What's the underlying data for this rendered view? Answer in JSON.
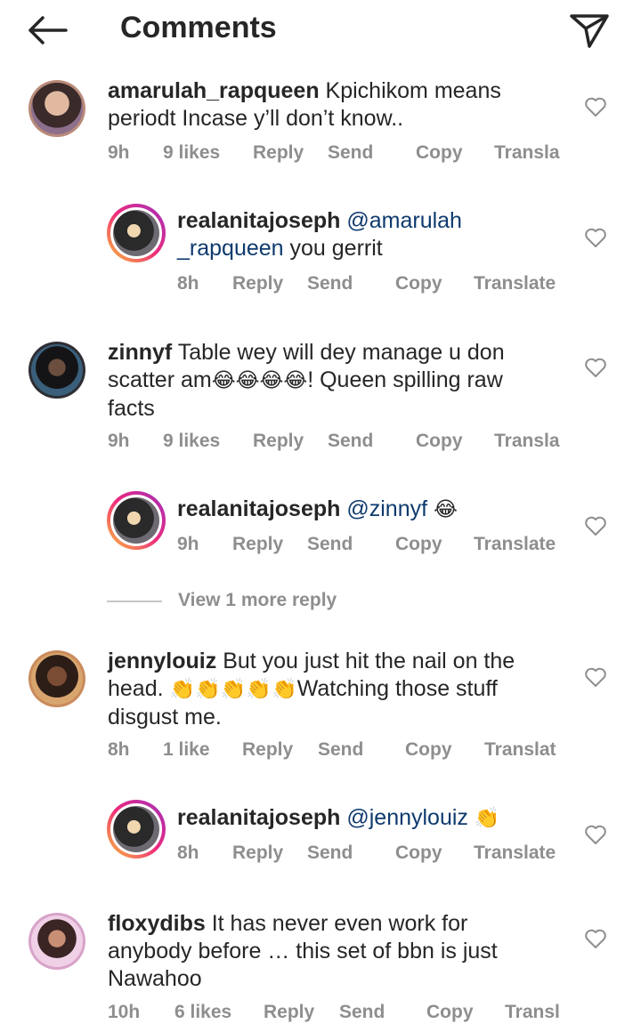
{
  "header": {
    "title": "Comments",
    "back_icon": "arrow-left-icon",
    "send_icon": "paper-plane-icon"
  },
  "comments": [
    {
      "user": "amarulah_rapqueen",
      "text": "Kpichikom means",
      "text2": "periodt Incase y’ll don’t know..",
      "time": "9h",
      "likes": "9 likes",
      "reply": "Reply",
      "send": "Send",
      "copy": "Copy",
      "translate": "Transla"
    },
    {
      "user": "realanitajoseph",
      "mention": "@amarulah",
      "mention2": "_rapqueen",
      "text2": " you gerrit",
      "time": "8h",
      "reply": "Reply",
      "send": "Send",
      "copy": "Copy",
      "translate": "Translate"
    },
    {
      "user": "zinnyf",
      "text": "Table wey will dey manage  u don",
      "text2a": "scatter am",
      "emoji2": "😂😂😂😂",
      "text2b": "! Queen spilling  raw",
      "text3": "facts",
      "time": "9h",
      "likes": "9 likes",
      "reply": "Reply",
      "send": "Send",
      "copy": "Copy",
      "translate": "Transla"
    },
    {
      "user": "realanitajoseph",
      "mention": "@zinnyf",
      "emoji": "😂",
      "time": "9h",
      "reply": "Reply",
      "send": "Send",
      "copy": "Copy",
      "translate": "Translate"
    },
    {
      "user": "jennylouiz",
      "text": "But you just hit the nail on the",
      "text2a": "head. ",
      "emoji2": "👏👏👏👏👏",
      "text2b": "Watching those stuff",
      "text3": "disgust me.",
      "time": "8h",
      "likes": "1 like",
      "reply": "Reply",
      "send": "Send",
      "copy": "Copy",
      "translate": "Translat"
    },
    {
      "user": "realanitajoseph",
      "mention": "@jennylouiz",
      "emoji": "👏",
      "time": "8h",
      "reply": "Reply",
      "send": "Send",
      "copy": "Copy",
      "translate": "Translate"
    },
    {
      "user": "floxydibs",
      "text": "It has never even work for",
      "text2": "anybody before … this set of bbn is just",
      "text3": "Nawahoo",
      "time": "10h",
      "likes": "6 likes",
      "reply": "Reply",
      "send": "Send",
      "copy": "Copy",
      "translate": "Transl"
    }
  ],
  "view_more": "View 1 more reply",
  "icons": {
    "heart": "heart-outline-icon"
  },
  "colors": {
    "text": "#262626",
    "meta": "#8e8e8e",
    "mention": "#0e3a6e"
  }
}
